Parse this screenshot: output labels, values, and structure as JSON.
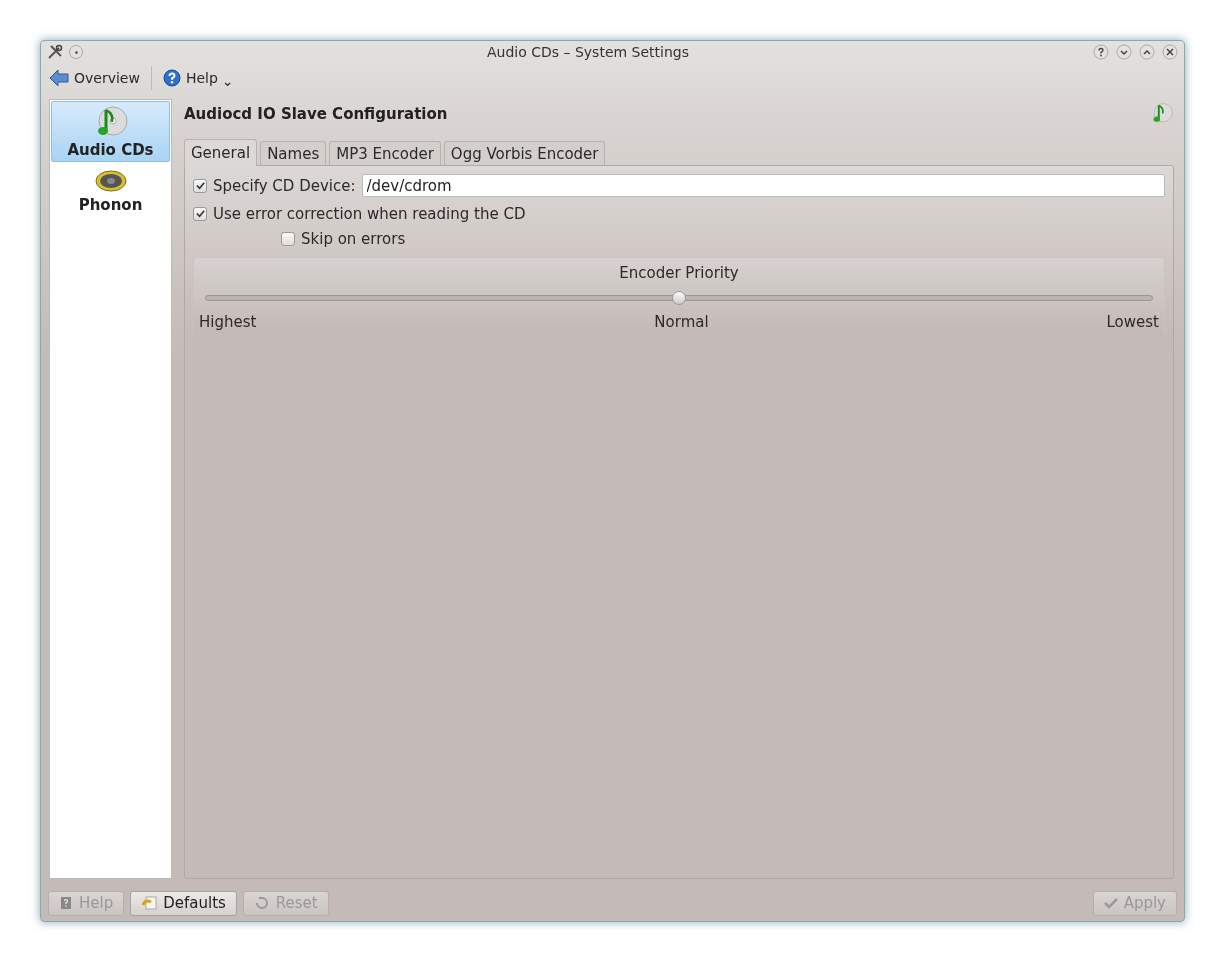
{
  "window": {
    "title": "Audio CDs – System Settings"
  },
  "toolbar": {
    "back": "Overview",
    "help": "Help",
    "help_caret": "⌄"
  },
  "sidebar": {
    "items": [
      {
        "label": "Audio CDs",
        "selected": true,
        "kind": "cd"
      },
      {
        "label": "Phonon",
        "selected": false,
        "kind": "speaker"
      }
    ]
  },
  "page": {
    "title": "Audiocd IO Slave Configuration",
    "tabs": [
      {
        "label": "General",
        "selected": true
      },
      {
        "label": "Names",
        "selected": false
      },
      {
        "label": "MP3 Encoder",
        "selected": false
      },
      {
        "label": "Ogg Vorbis Encoder",
        "selected": false
      }
    ],
    "device": {
      "label": "Specify CD Device:",
      "checked": true,
      "value": "/dev/cdrom"
    },
    "error_correction": {
      "label": "Use error correction when reading the CD",
      "checked": true
    },
    "skip_errors": {
      "label": "Skip on errors",
      "checked": false
    },
    "priority": {
      "title": "Encoder Priority",
      "level": 0.5,
      "labels": [
        "Highest",
        "Normal",
        "Lowest"
      ]
    }
  },
  "buttons": [
    {
      "label": "Help",
      "disabled": true,
      "kind": "help"
    },
    {
      "label": "Defaults",
      "disabled": false,
      "kind": "defaults"
    },
    {
      "label": "Reset",
      "disabled": true,
      "kind": "reset"
    },
    {
      "label": "Apply",
      "disabled": true,
      "kind": "apply"
    }
  ]
}
